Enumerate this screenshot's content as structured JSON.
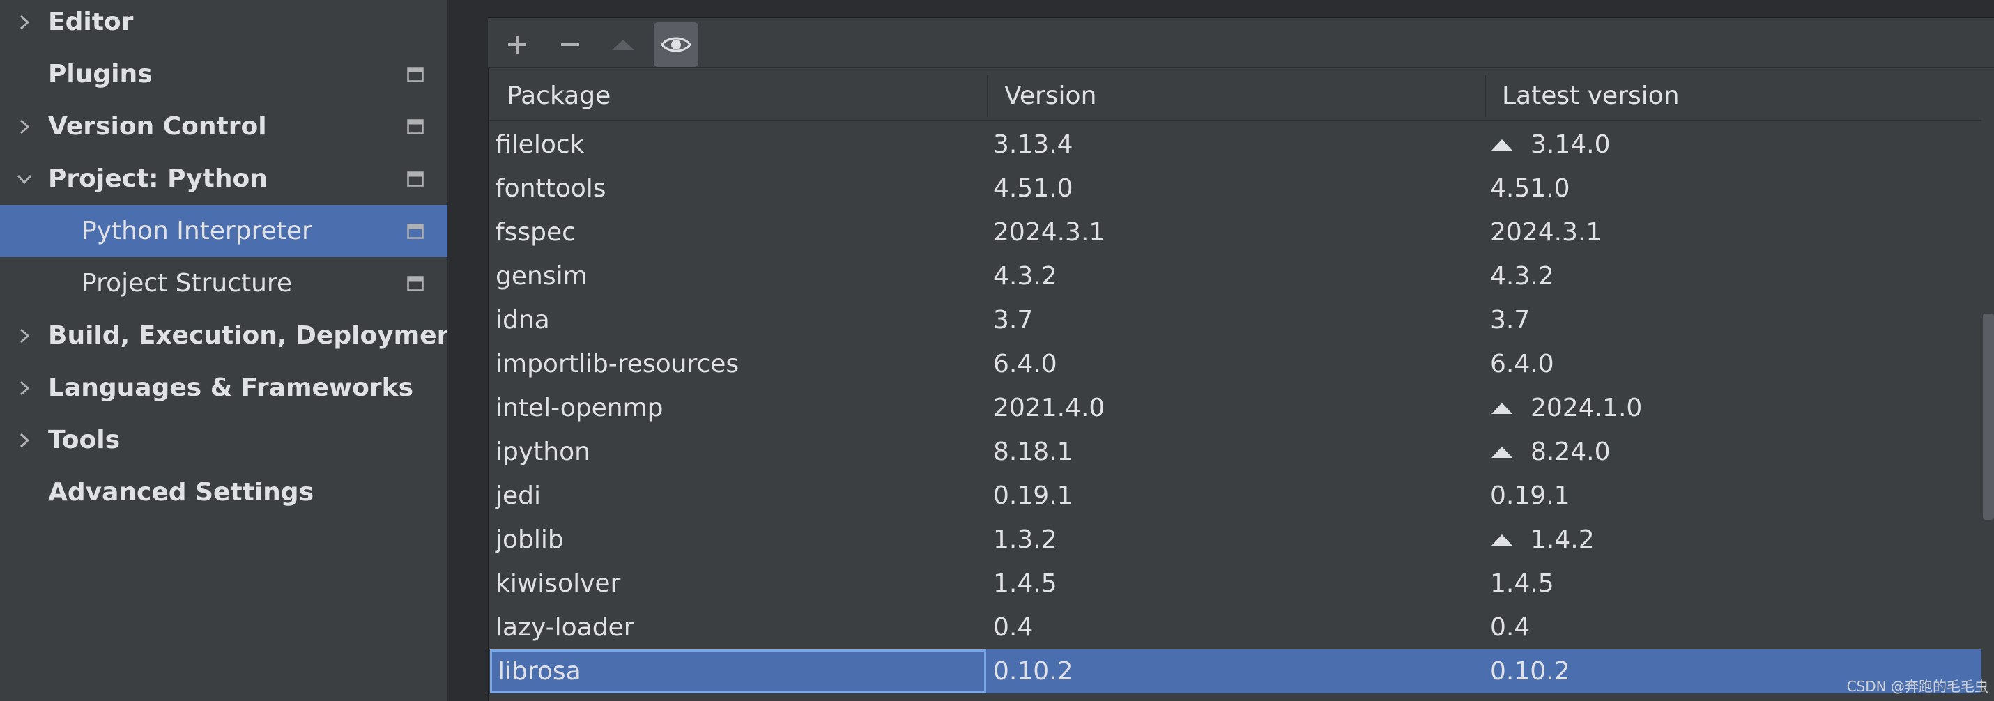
{
  "sidebar": {
    "items": [
      {
        "label": "Editor",
        "expandable": true,
        "expanded": false,
        "bold": true,
        "project_icon": false,
        "selected": false
      },
      {
        "label": "Plugins",
        "expandable": false,
        "expanded": false,
        "bold": true,
        "project_icon": true,
        "selected": false
      },
      {
        "label": "Version Control",
        "expandable": true,
        "expanded": false,
        "bold": true,
        "project_icon": true,
        "selected": false
      },
      {
        "label": "Project: Python",
        "expandable": true,
        "expanded": true,
        "bold": true,
        "project_icon": true,
        "selected": false
      },
      {
        "label": "Python Interpreter",
        "expandable": false,
        "expanded": false,
        "bold": false,
        "project_icon": true,
        "selected": true
      },
      {
        "label": "Project Structure",
        "expandable": false,
        "expanded": false,
        "bold": false,
        "project_icon": true,
        "selected": false
      },
      {
        "label": "Build, Execution, Deployment",
        "expandable": true,
        "expanded": false,
        "bold": true,
        "project_icon": false,
        "selected": false
      },
      {
        "label": "Languages & Frameworks",
        "expandable": true,
        "expanded": false,
        "bold": true,
        "project_icon": false,
        "selected": false
      },
      {
        "label": "Tools",
        "expandable": true,
        "expanded": false,
        "bold": true,
        "project_icon": false,
        "selected": false
      },
      {
        "label": "Advanced Settings",
        "expandable": false,
        "expanded": false,
        "bold": true,
        "project_icon": false,
        "selected": false
      }
    ]
  },
  "toolbar": {
    "buttons": [
      {
        "name": "add-package-button",
        "icon": "plus-icon"
      },
      {
        "name": "remove-package-button",
        "icon": "minus-icon"
      },
      {
        "name": "upgrade-package-button",
        "icon": "upgrade-arrow-icon"
      },
      {
        "name": "show-early-releases-button",
        "icon": "eye-icon"
      }
    ]
  },
  "table": {
    "columns": [
      "Package",
      "Version",
      "Latest version"
    ],
    "rows": [
      {
        "package": "filelock",
        "version": "3.13.4",
        "latest": "3.14.0",
        "upgrade": true,
        "selected": false
      },
      {
        "package": "fonttools",
        "version": "4.51.0",
        "latest": "4.51.0",
        "upgrade": false,
        "selected": false
      },
      {
        "package": "fsspec",
        "version": "2024.3.1",
        "latest": "2024.3.1",
        "upgrade": false,
        "selected": false
      },
      {
        "package": "gensim",
        "version": "4.3.2",
        "latest": "4.3.2",
        "upgrade": false,
        "selected": false
      },
      {
        "package": "idna",
        "version": "3.7",
        "latest": "3.7",
        "upgrade": false,
        "selected": false
      },
      {
        "package": "importlib-resources",
        "version": "6.4.0",
        "latest": "6.4.0",
        "upgrade": false,
        "selected": false
      },
      {
        "package": "intel-openmp",
        "version": "2021.4.0",
        "latest": "2024.1.0",
        "upgrade": true,
        "selected": false
      },
      {
        "package": "ipython",
        "version": "8.18.1",
        "latest": "8.24.0",
        "upgrade": true,
        "selected": false
      },
      {
        "package": "jedi",
        "version": "0.19.1",
        "latest": "0.19.1",
        "upgrade": false,
        "selected": false
      },
      {
        "package": "joblib",
        "version": "1.3.2",
        "latest": "1.4.2",
        "upgrade": true,
        "selected": false
      },
      {
        "package": "kiwisolver",
        "version": "1.4.5",
        "latest": "1.4.5",
        "upgrade": false,
        "selected": false
      },
      {
        "package": "lazy-loader",
        "version": "0.4",
        "latest": "0.4",
        "upgrade": false,
        "selected": false
      },
      {
        "package": "librosa",
        "version": "0.10.2",
        "latest": "0.10.2",
        "upgrade": false,
        "selected": true
      }
    ]
  },
  "watermark": "CSDN @奔跑的毛毛虫",
  "colors": {
    "sidebar_bg": "#3c3f41",
    "selection": "#4b6eaf",
    "text": "#dfe1e5",
    "icon": "#afb1b3"
  }
}
